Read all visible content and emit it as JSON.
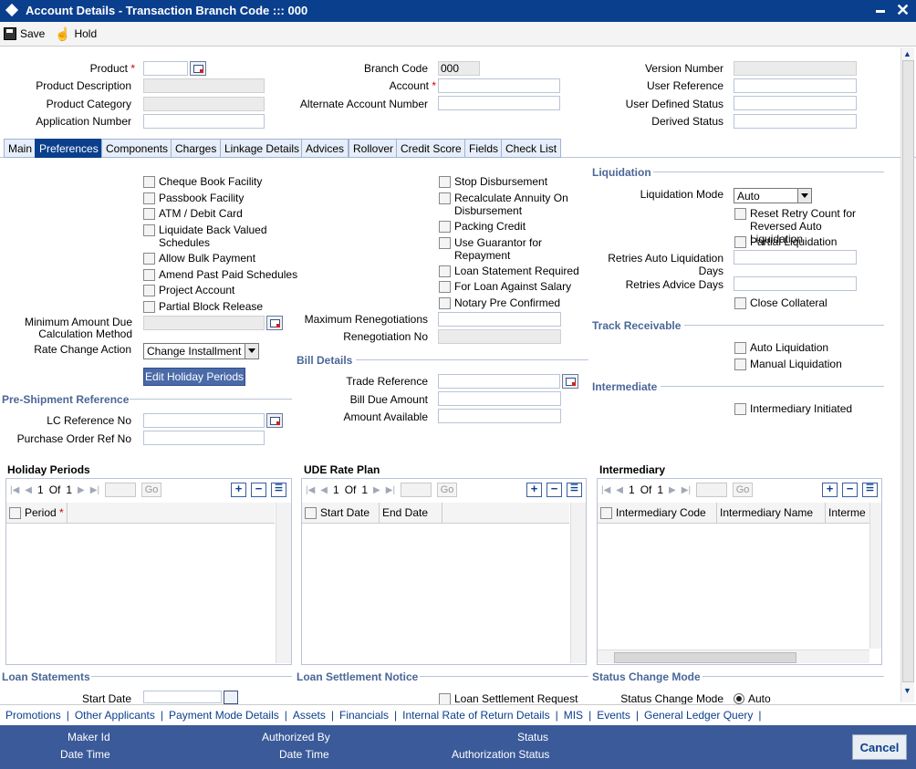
{
  "window": {
    "title": "Account Details - Transaction Branch Code ::: 000"
  },
  "toolbar": {
    "save": "Save",
    "hold": "Hold"
  },
  "header": {
    "product": "Product",
    "product_description": "Product Description",
    "product_category": "Product Category",
    "application_number": "Application Number",
    "branch_code": "Branch Code",
    "branch_code_value": "000",
    "account": "Account",
    "alternate_account_number": "Alternate Account Number",
    "version_number": "Version Number",
    "user_reference": "User Reference",
    "user_defined_status": "User Defined Status",
    "derived_status": "Derived Status",
    "required_mark": "*"
  },
  "tabs": [
    "Main",
    "Preferences",
    "Components",
    "Charges",
    "Linkage Details",
    "Advices",
    "Rollover",
    "Credit Score",
    "Fields",
    "Check List"
  ],
  "prefs": {
    "left_checks": [
      "Cheque Book Facility",
      "Passbook Facility",
      "ATM / Debit Card",
      "Liquidate Back Valued Schedules",
      "Allow Bulk Payment",
      "Amend Past Paid Schedules",
      "Project Account",
      "Partial Block Release"
    ],
    "min_amount_due": "Minimum Amount Due Calculation Method",
    "rate_change_action": "Rate Change Action",
    "rate_change_value": "Change Installment",
    "edit_holiday": "Edit Holiday Periods",
    "mid_checks": [
      "Stop Disbursement",
      "Recalculate Annuity On Disbursement",
      "Packing Credit",
      "Use Guarantor for Repayment",
      "Loan Statement Required",
      "For Loan Against Salary",
      "Notary Pre Confirmed"
    ],
    "max_renegotiations": "Maximum Renegotiations",
    "renegotiation_no": "Renegotiation No"
  },
  "liquidation": {
    "title": "Liquidation",
    "mode_label": "Liquidation Mode",
    "mode_value": "Auto",
    "reset_retry": "Reset Retry Count for Reversed Auto Liquidation",
    "partial": "Partial Liquidation",
    "retries_days": "Retries Auto Liquidation Days",
    "retries_advice": "Retries Advice Days",
    "close_collateral": "Close Collateral"
  },
  "track": {
    "title": "Track Receivable",
    "auto": "Auto Liquidation",
    "manual": "Manual Liquidation"
  },
  "intermediate": {
    "title": "Intermediate",
    "initiated": "Intermediary Initiated"
  },
  "bill": {
    "title": "Bill Details",
    "trade_reference": "Trade Reference",
    "bill_due": "Bill Due Amount",
    "amount_available": "Amount Available"
  },
  "preship": {
    "title": "Pre-Shipment Reference",
    "lc_ref": "LC Reference No",
    "po_ref": "Purchase Order Ref No"
  },
  "grids": {
    "holiday": {
      "title": "Holiday Periods",
      "page": "1",
      "of": "Of",
      "total": "1",
      "go": "Go",
      "cols": [
        "Period"
      ]
    },
    "ude": {
      "title": "UDE Rate Plan",
      "page": "1",
      "of": "Of",
      "total": "1",
      "go": "Go",
      "cols": [
        "Start Date",
        "End Date"
      ]
    },
    "intermediary": {
      "title": "Intermediary",
      "page": "1",
      "of": "Of",
      "total": "1",
      "go": "Go",
      "cols": [
        "Intermediary Code",
        "Intermediary Name",
        "Interme"
      ]
    }
  },
  "lower": {
    "loan_statements": "Loan Statements",
    "start_date": "Start Date",
    "loan_settlement_notice": "Loan Settlement Notice",
    "loan_settlement_request": "Loan Settlement Request",
    "status_change_mode": "Status Change Mode",
    "status_change_mode_label": "Status Change Mode",
    "status_change_value": "Auto"
  },
  "links": [
    "Promotions",
    "Other Applicants",
    "Payment Mode Details",
    "Assets",
    "Financials",
    "Internal Rate of Return Details",
    "MIS",
    "Events",
    "General Ledger Query"
  ],
  "link_separator": "|",
  "footer": {
    "maker_id": "Maker Id",
    "date_time": "Date Time",
    "authorized_by": "Authorized By",
    "status": "Status",
    "authorization_status": "Authorization Status",
    "cancel": "Cancel"
  },
  "colors": {
    "title_bar": "#0a3f8d",
    "footer": "#3b5a99",
    "section": "#4b6797"
  }
}
